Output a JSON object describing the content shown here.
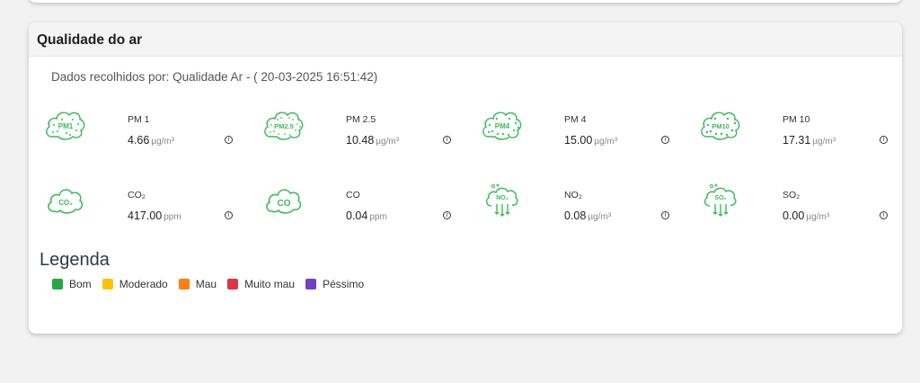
{
  "card": {
    "title": "Qualidade do ar",
    "collected_by": "Dados recolhidos por: Qualidade Ar - ( 20-03-2025 16:51:42)"
  },
  "info_symbol": "i",
  "pollutants": [
    {
      "icon": "pm1-cloud-icon",
      "name": "PM 1",
      "value": "4.66",
      "unit": "µg/m³"
    },
    {
      "icon": "pm25-cloud-icon",
      "name": "PM 2.5",
      "value": "10.48",
      "unit": "µg/m³"
    },
    {
      "icon": "pm4-cloud-icon",
      "name": "PM 4",
      "value": "15.00",
      "unit": "µg/m³"
    },
    {
      "icon": "pm10-cloud-icon",
      "name": "PM 10",
      "value": "17.31",
      "unit": "µg/m³"
    },
    {
      "icon": "co2-cloud-icon",
      "name": "CO₂",
      "value": "417.00",
      "unit": "ppm"
    },
    {
      "icon": "co-cloud-icon",
      "name": "CO",
      "value": "0.04",
      "unit": "ppm"
    },
    {
      "icon": "no2-cloud-icon",
      "name": "NO₂",
      "value": "0.08",
      "unit": "µg/m³"
    },
    {
      "icon": "so2-cloud-icon",
      "name": "SO₂",
      "value": "0.00",
      "unit": "µg/m³"
    }
  ],
  "icon_labels": {
    "pm1": "PM1",
    "pm25": "PM2.5",
    "pm4": "PM4",
    "pm10": "PM10",
    "co2": "CO₂",
    "co": "CO",
    "no2": "NO₂",
    "so2": "SO₂"
  },
  "legend": {
    "title": "Legenda",
    "items": [
      {
        "label": "Bom",
        "color": "#28a745"
      },
      {
        "label": "Moderado",
        "color": "#ffc107"
      },
      {
        "label": "Mau",
        "color": "#fd7e14"
      },
      {
        "label": "Muito mau",
        "color": "#dc3545"
      },
      {
        "label": "Péssimo",
        "color": "#6f42c1"
      }
    ]
  },
  "colors": {
    "icon_green": "#3dba5a"
  }
}
